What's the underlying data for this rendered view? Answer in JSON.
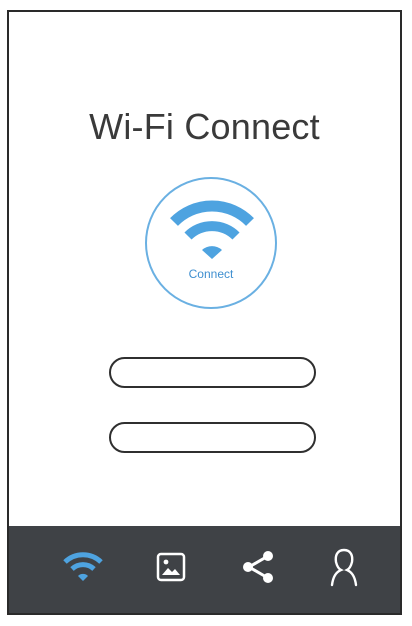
{
  "app": {
    "title": "Wi-Fi Connect"
  },
  "connect_button": {
    "label": "Connect",
    "icon": "wifi-icon"
  },
  "fields": [
    {
      "value": "",
      "placeholder": ""
    },
    {
      "value": "",
      "placeholder": ""
    }
  ],
  "tabbar": {
    "items": [
      {
        "icon": "wifi-icon",
        "active": true
      },
      {
        "icon": "image-icon",
        "active": false
      },
      {
        "icon": "share-icon",
        "active": false
      },
      {
        "icon": "profile-icon",
        "active": false
      }
    ]
  },
  "colors": {
    "accent": "#4ea3e0",
    "tabbar_bg": "#3f4246",
    "tab_icon_inactive": "#ffffff",
    "title_text": "#3a3a3a"
  }
}
